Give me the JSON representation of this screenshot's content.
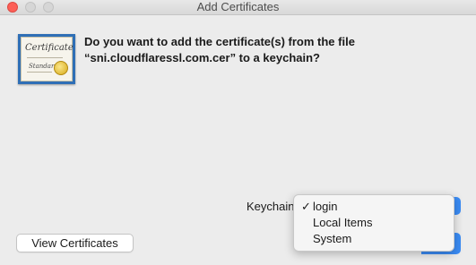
{
  "window": {
    "title": "Add Certificates"
  },
  "icon": {
    "name": "certificate-icon",
    "script_line1": "Certificate",
    "script_line2": "Standard"
  },
  "dialog": {
    "message_line1": "Do you want to add the certificate(s) from the file",
    "message_line2": "“sni.cloudflaressl.com.cer” to a keychain?"
  },
  "keychain": {
    "label": "Keychain",
    "selected": "login",
    "options": [
      {
        "label": "login",
        "checked": true,
        "check": "✓"
      },
      {
        "label": "Local Items",
        "checked": false,
        "check": ""
      },
      {
        "label": "System",
        "checked": false,
        "check": ""
      }
    ],
    "popup_arrows": "⌃⌄"
  },
  "buttons": {
    "view_certificates": "View Certificates"
  },
  "colors": {
    "accent": "#3b8cf5",
    "close": "#fd5f57",
    "window_bg": "#ececec"
  }
}
